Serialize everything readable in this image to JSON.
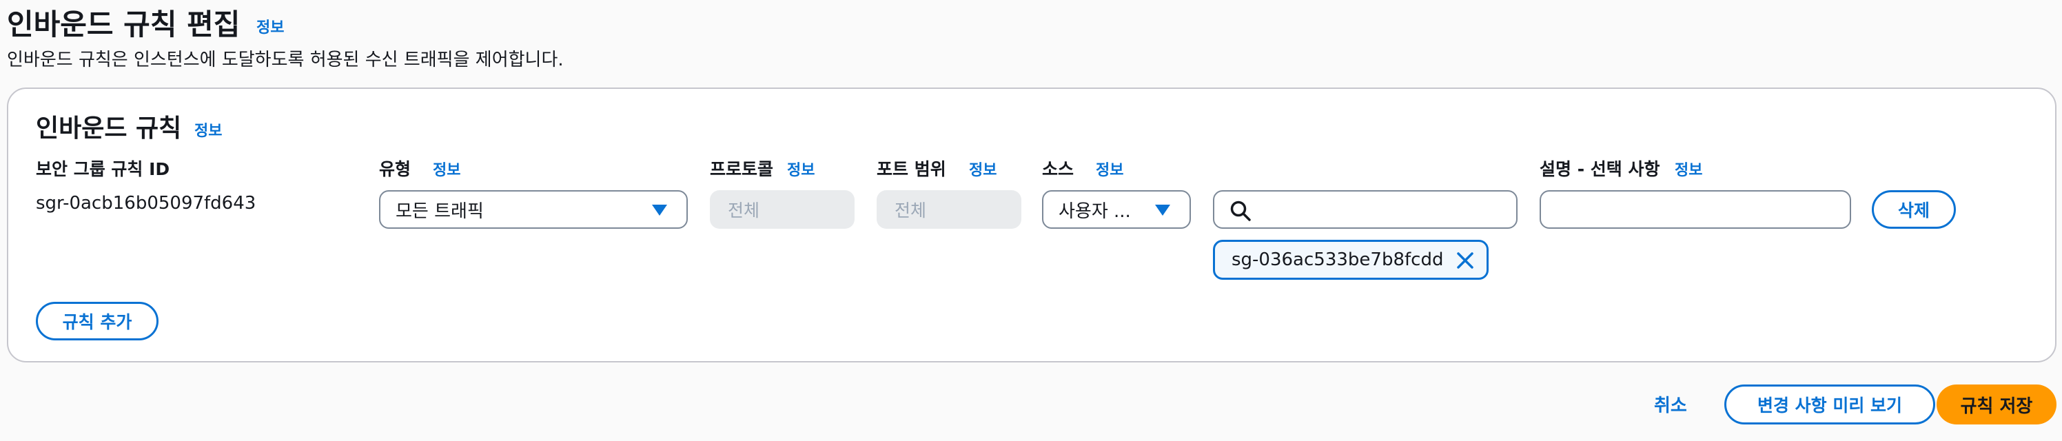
{
  "page": {
    "title": "인바운드 규칙 편집",
    "info": "정보",
    "description": "인바운드 규칙은 인스턴스에 도달하도록 허용된 수신 트래픽을 제어합니다."
  },
  "panel": {
    "title": "인바운드 규칙",
    "info": "정보",
    "columns": {
      "rule_id": "보안 그룹 규칙 ID",
      "type": "유형",
      "protocol": "프로토콜",
      "port_range": "포트 범위",
      "source": "소스",
      "description": "설명 - 선택 사항"
    },
    "info_label": "정보",
    "rule": {
      "id": "sgr-0acb16b05097fd643",
      "type_value": "모든 트래픽",
      "protocol_value": "전체",
      "port_value": "전체",
      "source_value": "사용자 ...",
      "search_value": "",
      "description_value": "",
      "delete_label": "삭제",
      "source_token": "sg-036ac533be7b8fcdd"
    },
    "add_rule_label": "규칙 추가"
  },
  "footer": {
    "cancel_label": "취소",
    "preview_label": "변경 사항 미리 보기",
    "save_label": "규칙 저장"
  },
  "colors": {
    "accent": "#0972d3",
    "primary_button": "#ff9900"
  }
}
